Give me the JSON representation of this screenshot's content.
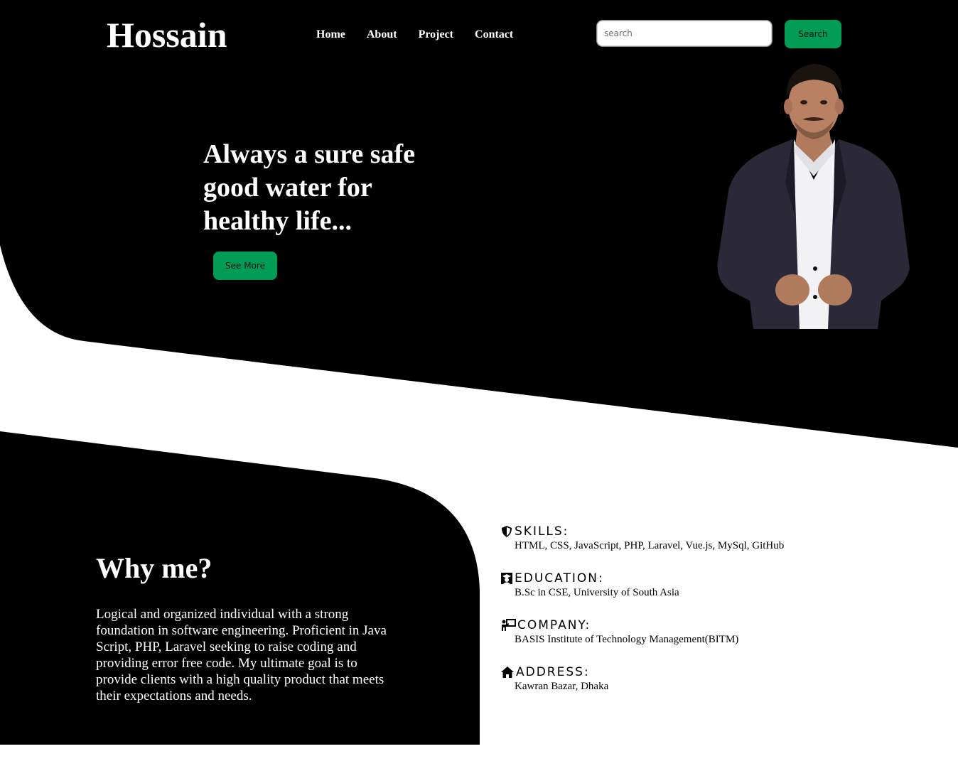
{
  "header": {
    "logo": "Hossain",
    "nav": [
      {
        "label": "Home"
      },
      {
        "label": "About"
      },
      {
        "label": "Project"
      },
      {
        "label": "Contact"
      }
    ],
    "search_placeholder": "search",
    "search_button": "Search"
  },
  "hero": {
    "title": "Always a sure safe good water for healthy life...",
    "button": "See More"
  },
  "why": {
    "title": "Why me?",
    "text": "Logical and organized individual with a strong foundation in software engineering. Proficient in Java Script, PHP, Laravel seeking to raise coding and providing error free code. My ultimate goal is to provide clients with a high quality product that meets their expectations and needs."
  },
  "info": [
    {
      "icon": "shield-icon",
      "label": "SKILLS:",
      "value": "HTML, CSS, JavaScript, PHP, Laravel, Vue.js, MySql, GitHub"
    },
    {
      "icon": "graduate-icon",
      "label": "EDUCATION:",
      "value": "B.Sc in CSE, University of South Asia"
    },
    {
      "icon": "presenter-icon",
      "label": "COMPANY:",
      "value": "BASIS Institute of Technology Management(BITM)"
    },
    {
      "icon": "home-icon",
      "label": "ADDRESS:",
      "value": "Kawran Bazar, Dhaka"
    }
  ],
  "colors": {
    "accent": "#009b55",
    "background_dark": "#000000",
    "background_light": "#ffffff"
  }
}
